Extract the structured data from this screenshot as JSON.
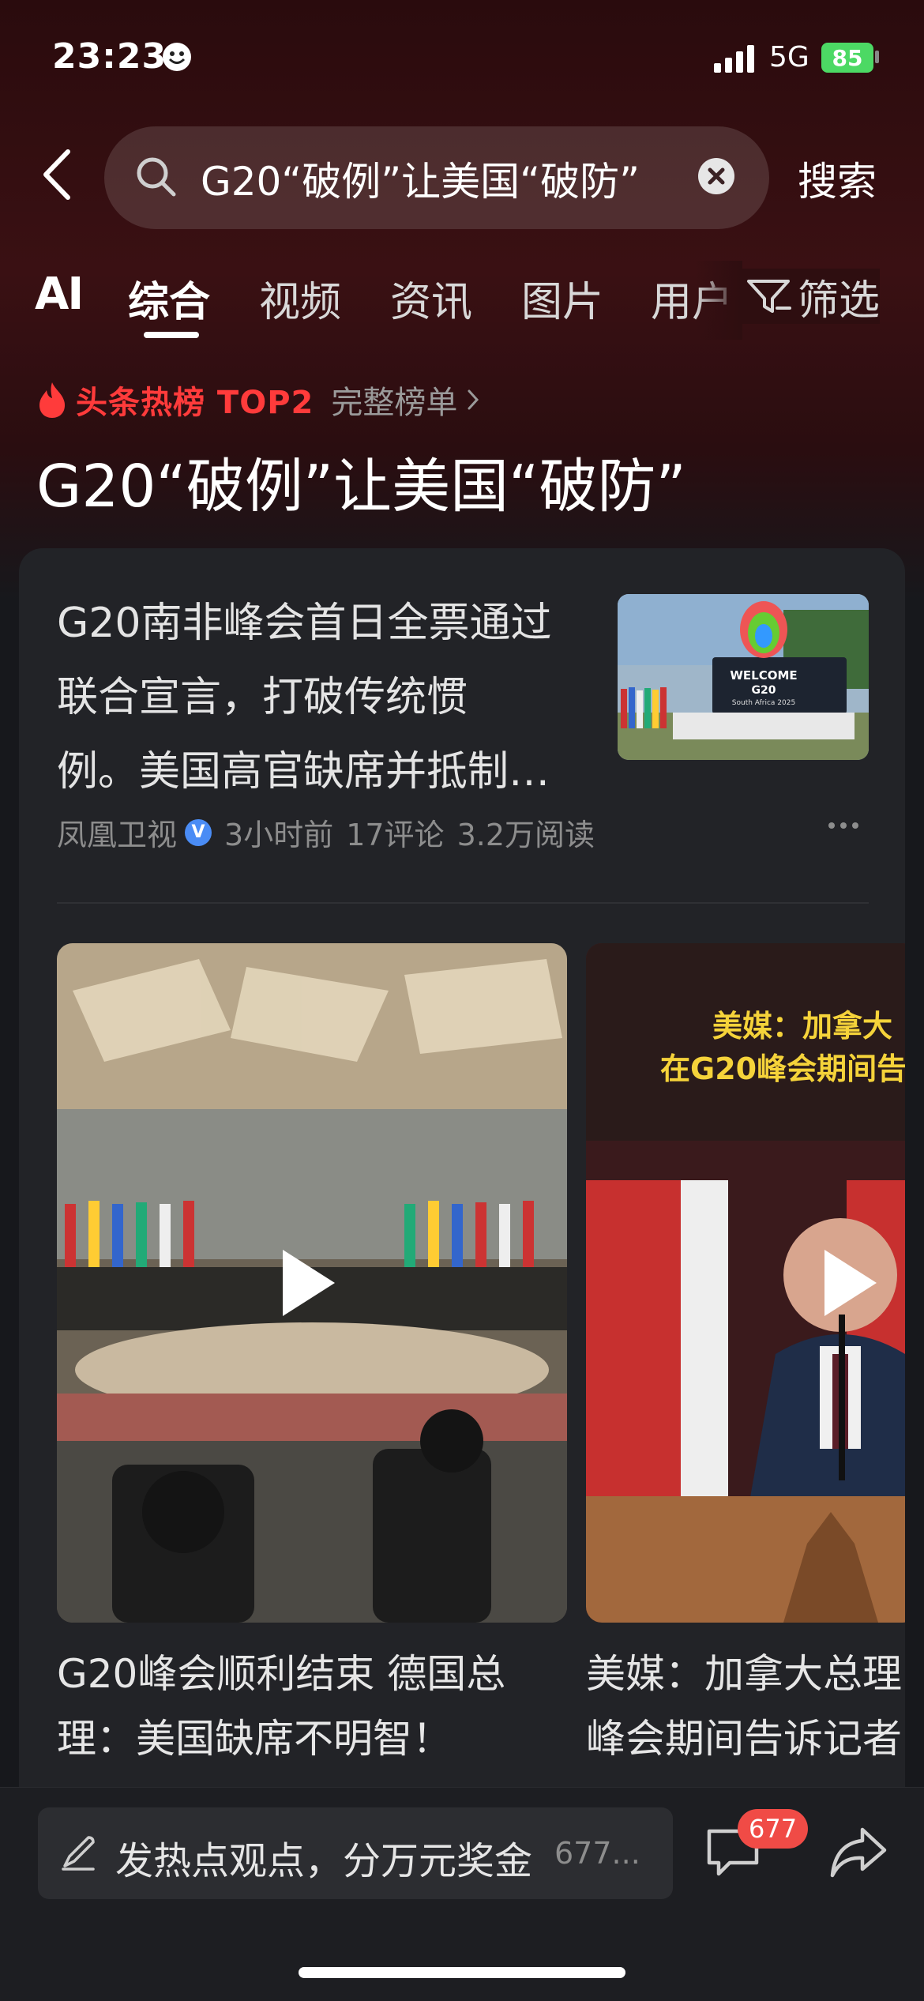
{
  "status_bar": {
    "time": "23:23",
    "network": "5G",
    "battery": "85"
  },
  "search": {
    "query": "G20“破例”让美国“破防”",
    "button": "搜索"
  },
  "tabs": [
    "AI",
    "综合",
    "视频",
    "资讯",
    "图片",
    "用户"
  ],
  "active_tab": "综合",
  "filter_label": "筛选",
  "hot": {
    "label": "头条热榜 TOP2",
    "full_list": "完整榜单"
  },
  "headline": "G20“破例”让美国“破防”",
  "article": {
    "title_lines": [
      "G20南非峰会首日全票通过",
      "联合宣言，打破传统惯",
      "例。美国高官缺席并抵制…"
    ],
    "source": "凤凰卫视",
    "verified_mark": "V",
    "time": "3小时前",
    "comments": "17评论",
    "reads": "3.2万阅读",
    "thumb_sign": {
      "line1": "WELCOME",
      "line2": "G20",
      "line3": "South Africa 2025"
    }
  },
  "videos": [
    {
      "caption_lines": [
        "G20峰会顺利结束 德国总",
        "理：美国缺席不明智！"
      ]
    },
    {
      "overlay_lines": [
        "美媒：加拿大",
        "在G20峰会期间告"
      ],
      "caption_lines": [
        "美媒：加拿大总理",
        "峰会期间告诉记者"
      ]
    }
  ],
  "bottom_bar": {
    "comment_placeholder": "发热点观点，分万元奖金",
    "comment_hint": "677...",
    "badge_count": "677"
  },
  "colors": {
    "accent_red": "#ff3b3b",
    "badge_red": "#f04b46",
    "battery_green": "#4cd964"
  }
}
